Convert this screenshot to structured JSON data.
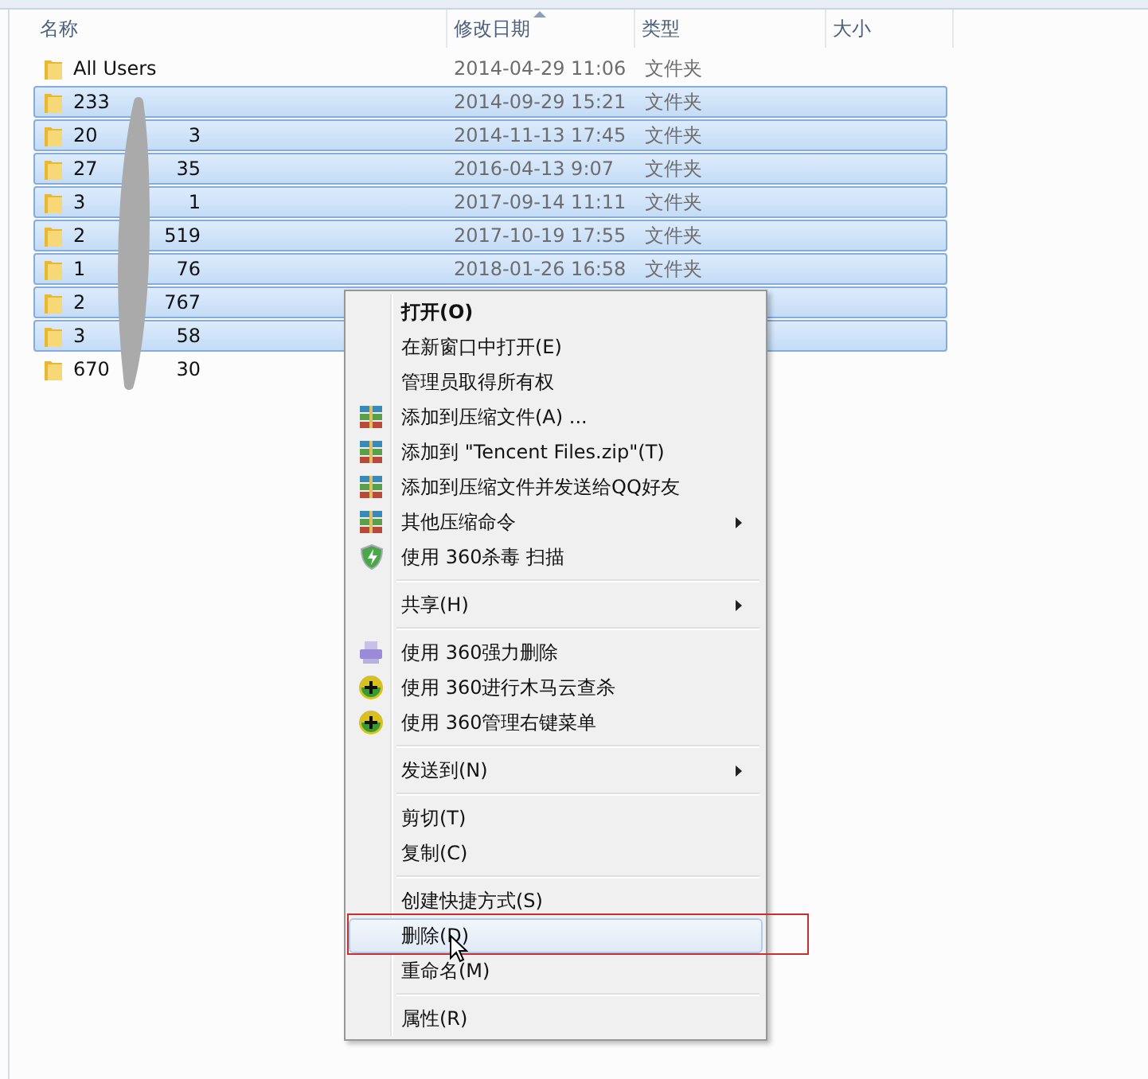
{
  "columns": [
    {
      "label": "名称",
      "sorted": false
    },
    {
      "label": "修改日期",
      "sorted": true
    },
    {
      "label": "类型",
      "sorted": false
    },
    {
      "label": "大小",
      "sorted": false
    }
  ],
  "files": [
    {
      "name_start": "All Users",
      "date": "2014-04-29 11:06",
      "type": "文件夹",
      "selected": false
    },
    {
      "name_start": "233",
      "date": "2014-09-29 15:21",
      "type": "文件夹",
      "selected": true
    },
    {
      "name_start": "20",
      "name_end": "3",
      "date": "2014-11-13 17:45",
      "type": "文件夹",
      "selected": true
    },
    {
      "name_start": "27",
      "name_end": "35",
      "date": "2016-04-13 9:07",
      "type": "文件夹",
      "selected": true
    },
    {
      "name_start": "3",
      "name_end": "1",
      "date": "2017-09-14 11:11",
      "type": "文件夹",
      "selected": true
    },
    {
      "name_start": "2",
      "name_end": "519",
      "date": "2017-10-19 17:55",
      "type": "文件夹",
      "selected": true
    },
    {
      "name_start": "1",
      "name_end": "76",
      "date": "2018-01-26 16:58",
      "type": "文件夹",
      "selected": true
    },
    {
      "name_start": "2",
      "name_end": "767",
      "selected": true
    },
    {
      "name_start": "3",
      "name_end": "58",
      "selected": true
    },
    {
      "name_start": "670",
      "name_end": "30",
      "selected": false
    }
  ],
  "context_menu": [
    {
      "kind": "item",
      "label": "打开(O)",
      "default": true,
      "selected": false
    },
    {
      "kind": "item",
      "label": "在新窗口中打开(E)",
      "selected": false
    },
    {
      "kind": "item",
      "label": "管理员取得所有权",
      "selected": false
    },
    {
      "kind": "archive",
      "label": "添加到压缩文件(A) ...",
      "selected": false
    },
    {
      "kind": "archive",
      "label": "添加到 \"Tencent Files.zip\"(T)",
      "selected": false
    },
    {
      "kind": "archive",
      "label": "添加到压缩文件并发送给QQ好友",
      "selected": false
    },
    {
      "kind": "archive",
      "label": "其他压缩命令",
      "submenu": true,
      "selected": false
    },
    {
      "kind": "shield",
      "label": "使用 360杀毒 扫描",
      "selected": false
    },
    {
      "kind": "separator"
    },
    {
      "kind": "item",
      "label": "共享(H)",
      "submenu": true,
      "selected": false
    },
    {
      "kind": "separator"
    },
    {
      "kind": "shredder",
      "label": "使用 360强力删除",
      "selected": false
    },
    {
      "kind": "plus",
      "label": "使用 360进行木马云查杀",
      "selected": false
    },
    {
      "kind": "plus",
      "label": "使用 360管理右键菜单",
      "selected": false
    },
    {
      "kind": "separator"
    },
    {
      "kind": "item",
      "label": "发送到(N)",
      "submenu": true,
      "selected": false
    },
    {
      "kind": "separator"
    },
    {
      "kind": "item",
      "label": "剪切(T)",
      "selected": false
    },
    {
      "kind": "item",
      "label": "复制(C)",
      "selected": false
    },
    {
      "kind": "separator"
    },
    {
      "kind": "item",
      "label": "创建快捷方式(S)",
      "selected": false
    },
    {
      "kind": "item",
      "label": "删除(D)",
      "selected": true
    },
    {
      "kind": "item",
      "label": "重命名(M)",
      "selected": false
    },
    {
      "kind": "separator"
    },
    {
      "kind": "item",
      "label": "属性(R)",
      "selected": false
    }
  ]
}
